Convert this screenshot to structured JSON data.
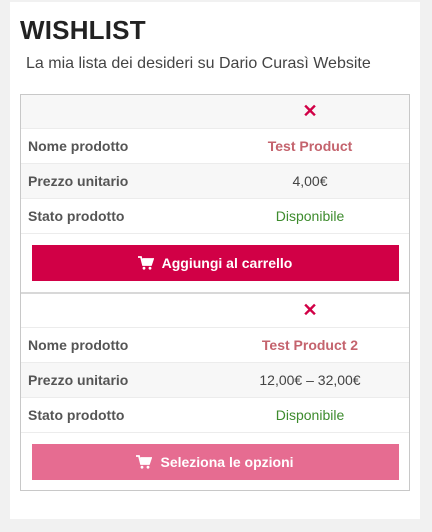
{
  "page": {
    "title": "WISHLIST",
    "subtitle": "La mia lista dei desideri su Dario Curasì Website"
  },
  "items": [
    {
      "close_glyph": "✕",
      "name_label": "Nome prodotto",
      "name": "Test Product",
      "price_label": "Prezzo unitario",
      "price": "4,00€",
      "stock_label": "Stato prodotto",
      "stock": "Disponibile",
      "button_label": "Aggiungi al carrello",
      "button_icon": "cart-icon",
      "button_color": "#d10046"
    },
    {
      "close_glyph": "✕",
      "name_label": "Nome prodotto",
      "name": "Test Product 2",
      "price_label": "Prezzo unitario",
      "price": "12,00€ – 32,00€",
      "stock_label": "Stato prodotto",
      "stock": "Disponibile",
      "button_label": "Seleziona le opzioni",
      "button_icon": "cart-icon",
      "button_color": "#e66c91"
    }
  ],
  "colors": {
    "accent": "#d10046",
    "product_link": "#c4636d",
    "in_stock": "#3d8b2d"
  }
}
